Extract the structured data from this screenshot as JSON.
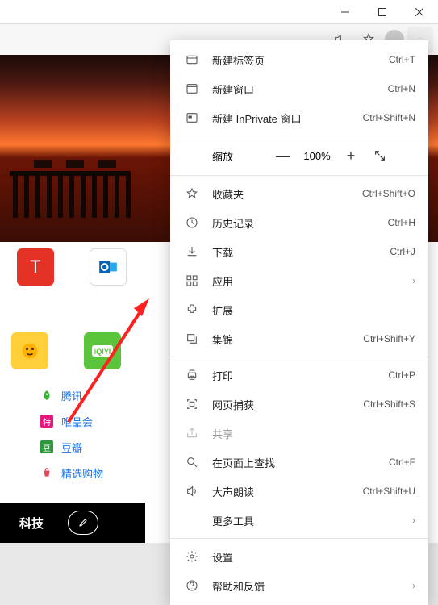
{
  "window": {
    "minimize": "—",
    "maximize": "☐",
    "close": "✕"
  },
  "menu": {
    "new_tab": "新建标签页",
    "new_tab_sc": "Ctrl+T",
    "new_window": "新建窗口",
    "new_window_sc": "Ctrl+N",
    "new_inprivate": "新建 InPrivate 窗口",
    "new_inprivate_sc": "Ctrl+Shift+N",
    "zoom": "缩放",
    "zoom_val": "100%",
    "favorites": "收藏夹",
    "favorites_sc": "Ctrl+Shift+O",
    "history": "历史记录",
    "history_sc": "Ctrl+H",
    "downloads": "下载",
    "downloads_sc": "Ctrl+J",
    "apps": "应用",
    "extensions": "扩展",
    "collections": "集锦",
    "collections_sc": "Ctrl+Shift+Y",
    "print": "打印",
    "print_sc": "Ctrl+P",
    "capture": "网页捕获",
    "capture_sc": "Ctrl+Shift+S",
    "share": "共享",
    "find": "在页面上查找",
    "find_sc": "Ctrl+F",
    "read_aloud": "大声朗读",
    "read_aloud_sc": "Ctrl+Shift+U",
    "more_tools": "更多工具",
    "settings": "设置",
    "help": "帮助和反馈"
  },
  "tiles": {
    "tmall": "天猫",
    "tmall_letter": "T",
    "outlook": "Outlook邮箱"
  },
  "links": {
    "tencent": "腾讯",
    "vip": "唯品会",
    "douban": "豆瓣",
    "shop": "精选购物",
    "vip_ic": "特",
    "douban_ic": "豆"
  },
  "bottom": {
    "tech": "科技"
  }
}
